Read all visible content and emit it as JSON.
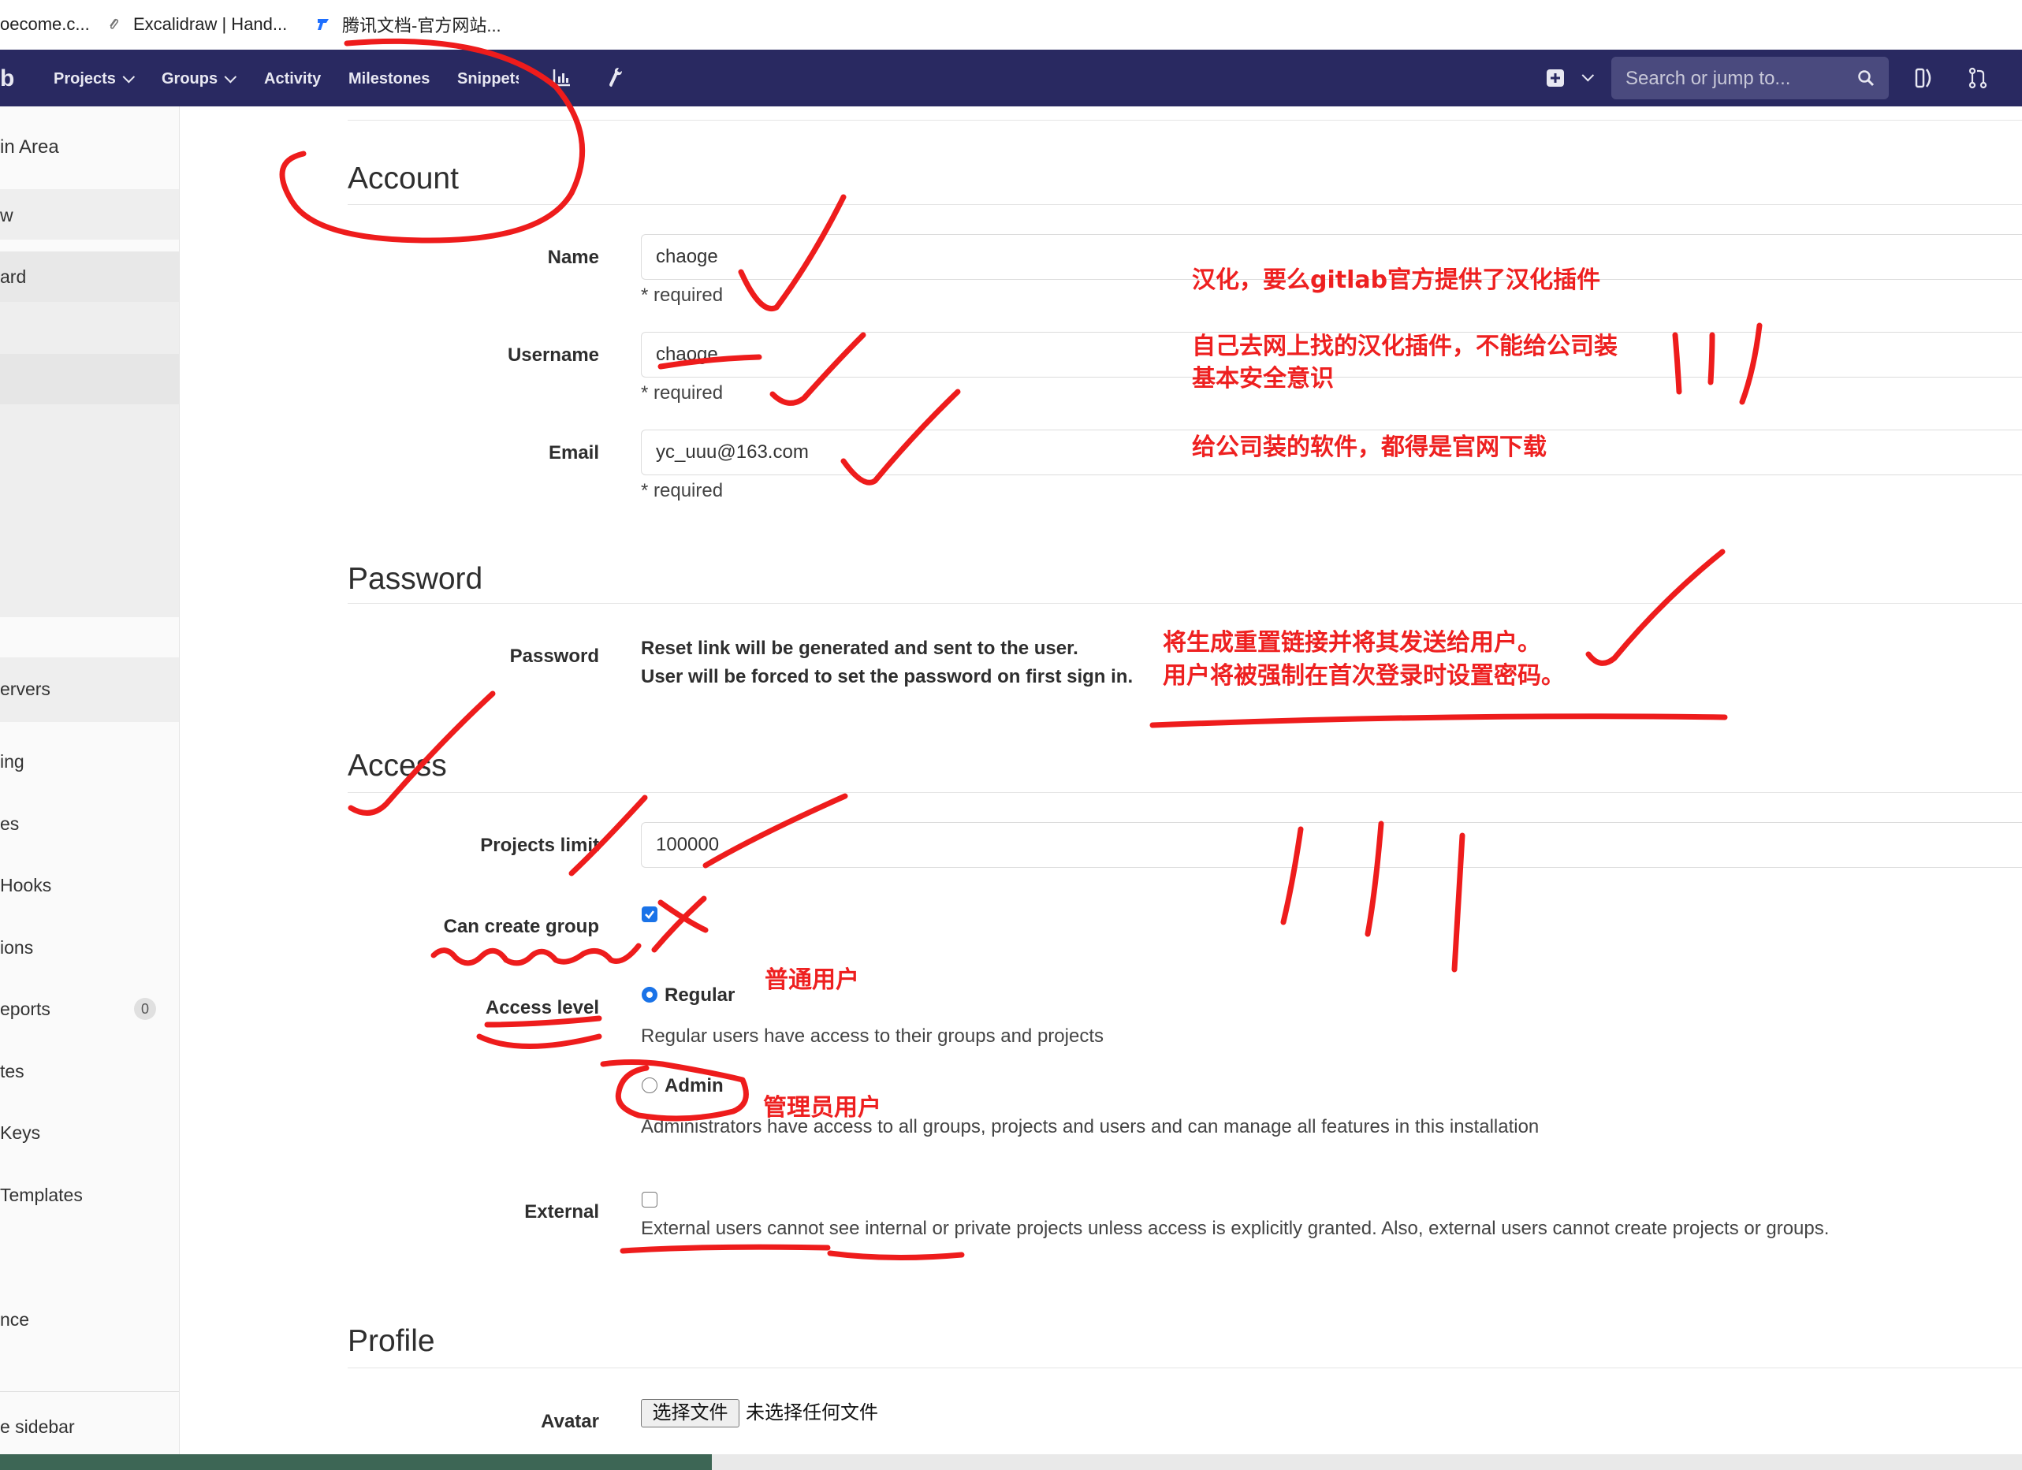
{
  "bookmarks": [
    {
      "label": "oecome.c..."
    },
    {
      "label": "Excalidraw | Hand..."
    },
    {
      "label": "腾讯文档-官方网站..."
    }
  ],
  "navbar": {
    "brand": "b",
    "items": [
      {
        "label": "Projects",
        "dropdown": true
      },
      {
        "label": "Groups",
        "dropdown": true
      },
      {
        "label": "Activity",
        "dropdown": false
      },
      {
        "label": "Milestones",
        "dropdown": false
      },
      {
        "label": "Snippets",
        "dropdown": false
      }
    ],
    "search_placeholder": "Search or jump to..."
  },
  "sidebar": {
    "header": "in Area",
    "items": [
      {
        "label": "w",
        "active": true
      },
      {
        "label": "ard",
        "active": true
      },
      {
        "label": "",
        "active": true
      },
      {
        "label": "ervers",
        "active": true
      },
      {
        "label": "ing",
        "active": false
      },
      {
        "label": "es",
        "active": false
      },
      {
        "label": "Hooks",
        "active": false
      },
      {
        "label": "ions",
        "active": false
      },
      {
        "label": "eports",
        "active": false,
        "badge": "0"
      },
      {
        "label": "tes",
        "active": false
      },
      {
        "label": "Keys",
        "active": false
      },
      {
        "label": "Templates",
        "active": false
      },
      {
        "label": "nce",
        "active": false
      }
    ],
    "footer": "e sidebar"
  },
  "account": {
    "title": "Account",
    "name_label": "Name",
    "name_value": "chaoge",
    "username_label": "Username",
    "username_value": "chaoge",
    "email_label": "Email",
    "email_value": "yc_uuu@163.com",
    "required": "* required"
  },
  "password": {
    "title": "Password",
    "label": "Password",
    "line1": "Reset link will be generated and sent to the user.",
    "line2": "User will be forced to set the password on first sign in."
  },
  "access": {
    "title": "Access",
    "projects_limit_label": "Projects limit",
    "projects_limit_value": "100000",
    "can_create_group_label": "Can create group",
    "can_create_group_checked": true,
    "access_level_label": "Access level",
    "regular_label": "Regular",
    "regular_help": "Regular users have access to their groups and projects",
    "admin_label": "Admin",
    "admin_help": "Administrators have access to all groups, projects and users and can manage all features in this installation",
    "selected_level": "Regular",
    "external_label": "External",
    "external_checked": false,
    "external_help": "External users cannot see internal or private projects unless access is explicitly granted. Also, external users cannot create projects or groups."
  },
  "profile": {
    "title": "Profile",
    "avatar_label": "Avatar",
    "file_button": "选择文件",
    "file_status": "未选择任何文件"
  },
  "annotations": {
    "note1": "汉化，要么gitlab官方提供了汉化插件",
    "note2_line1": "自己去网上找的汉化插件，不能给公司装",
    "note2_line2": "基本安全意识",
    "note3": "给公司装的软件，都得是官网下载",
    "note4_line1": "将生成重置链接并将其发送给用户。",
    "note4_line2": "用户将被强制在首次登录时设置密码。",
    "note5": "普通用户",
    "note6": "管理员用户"
  },
  "colors": {
    "navbar": "#292961",
    "annotation": "#ee2020",
    "checkbox_blue": "#1a73e8"
  }
}
